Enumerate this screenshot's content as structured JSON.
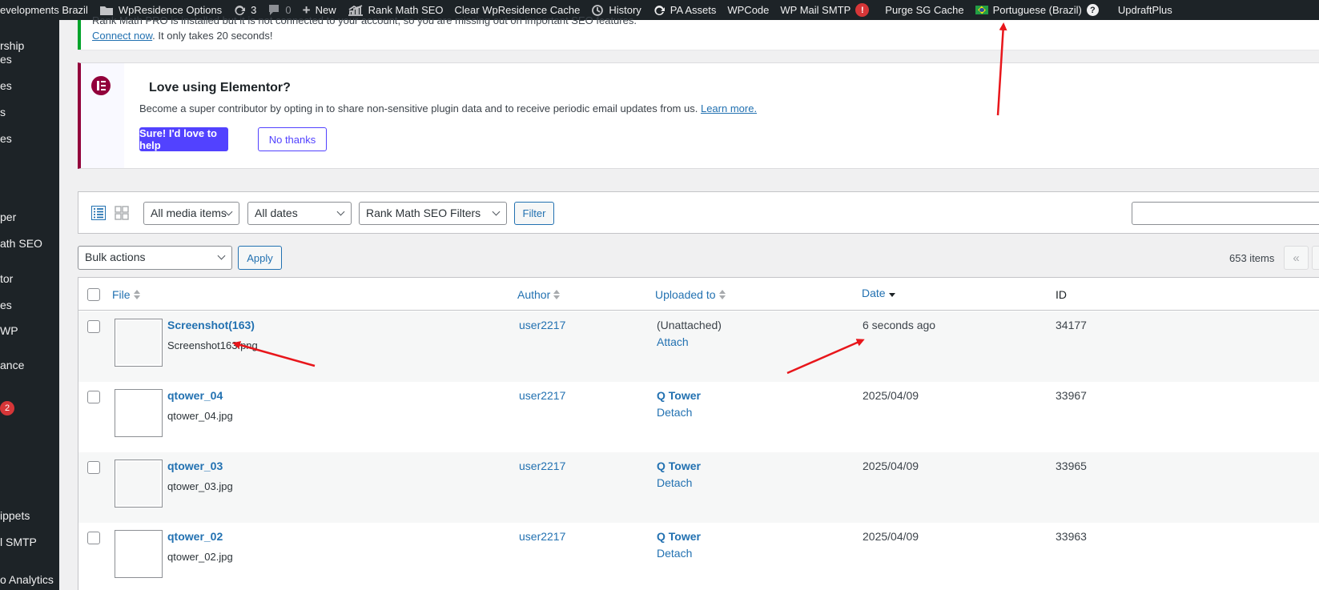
{
  "admin_bar": {
    "site_name": "evelopments Brazil",
    "wpresidence_options": "WpResidence Options",
    "updates_count": "3",
    "comments_count": "0",
    "new_label": "New",
    "rank_math": "Rank Math SEO",
    "clear_cache": "Clear WpResidence Cache",
    "history": "History",
    "pa_assets": "PA Assets",
    "wpcode": "WPCode",
    "wp_mail_smtp": "WP Mail SMTP",
    "wp_mail_smtp_badge": "!",
    "purge_sg": "Purge SG Cache",
    "language": "Portuguese (Brazil)",
    "help": "?",
    "updraftplus": "UpdraftPlus"
  },
  "sidebar": {
    "items": [
      "rship",
      "es",
      "es",
      "s",
      "es",
      "per",
      "ath SEO",
      "tor",
      "es",
      "WP",
      "ance",
      "ippets",
      "l SMTP",
      "o Analytics"
    ],
    "badge": "2"
  },
  "rankmath_notice": {
    "cut_text": "Rank Math PRO is installed but it is not connected to your account, so you are missing out on important SEO features.",
    "link": "Connect now",
    "text": ". It only takes 20 seconds!"
  },
  "elementor_notice": {
    "title": "Love using Elementor?",
    "text": "Become a super contributor by opting in to share non-sensitive plugin data and to receive periodic email updates from us.",
    "learn_more": "Learn more.",
    "primary_button": "Sure! I'd love to help",
    "secondary_button": "No thanks"
  },
  "toolbar": {
    "media_filter": "All media items",
    "date_filter": "All dates",
    "seo_filter": "Rank Math SEO Filters",
    "filter_button": "Filter",
    "search_value": ""
  },
  "bulk": {
    "bulk_actions": "Bulk actions",
    "apply": "Apply",
    "items_count": "653 items",
    "prev_page": "«"
  },
  "table": {
    "columns": {
      "file": "File",
      "author": "Author",
      "uploaded_to": "Uploaded to",
      "date": "Date",
      "id": "ID"
    },
    "rows": [
      {
        "title": "Screenshot(163)",
        "filename": "Screenshot163.png",
        "author": "user2217",
        "uploaded_to": "(Unattached)",
        "action": "Attach",
        "date": "6 seconds ago",
        "id": "34177"
      },
      {
        "title": "qtower_04",
        "filename": "qtower_04.jpg",
        "author": "user2217",
        "uploaded_to": "Q Tower",
        "action": "Detach",
        "date": "2025/04/09",
        "id": "33967"
      },
      {
        "title": "qtower_03",
        "filename": "qtower_03.jpg",
        "author": "user2217",
        "uploaded_to": "Q Tower",
        "action": "Detach",
        "date": "2025/04/09",
        "id": "33965"
      },
      {
        "title": "qtower_02",
        "filename": "qtower_02.jpg",
        "author": "user2217",
        "uploaded_to": "Q Tower",
        "action": "Detach",
        "date": "2025/04/09",
        "id": "33963"
      }
    ]
  },
  "colors": {
    "admin_bar": "#1d2327",
    "link": "#2271b1",
    "elementor_accent": "#92003b",
    "elementor_button": "#5242ff",
    "annotation_arrow": "#e8161b"
  }
}
